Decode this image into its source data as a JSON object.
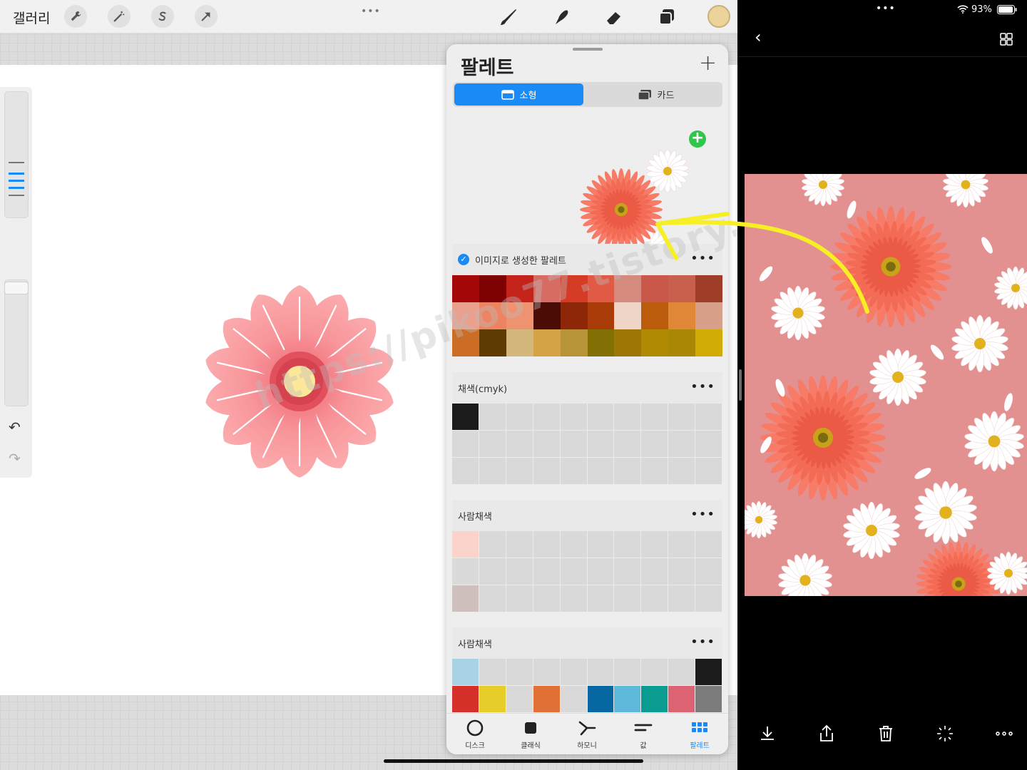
{
  "left_app": {
    "gallery_label": "갤러리",
    "top_more": "•••",
    "color_swatch": "#ebd39a"
  },
  "canvas": {
    "watermark": "https://pikoo77.tistory.com/"
  },
  "palette": {
    "title": "팔레트",
    "add_label": "+",
    "segments": {
      "small": "소형",
      "card": "카드"
    },
    "add_image": "+",
    "sections": [
      {
        "name": "이미지로 생성한 팔레트",
        "default": true,
        "colors": [
          "#a30707",
          "#7f0202",
          "#c4231a",
          "#d76c63",
          "#d63b26",
          "#e05a45",
          "#d58a7e",
          "#c9574a",
          "#c8604e",
          "#a03d28",
          "#e9a18e",
          "#ec8461",
          "#ee9270",
          "#4a0c04",
          "#8e2608",
          "#a93c08",
          "#efd5c8",
          "#bb5b0c",
          "#e08738",
          "#d8a08a",
          "#cc6d26",
          "#5f3c04",
          "#d4b77a",
          "#d3a346",
          "#b69437",
          "#837005",
          "#9d7605",
          "#b08a03",
          "#aa8805",
          "#d1ac04"
        ]
      },
      {
        "name": "채색(cmyk)",
        "colors": [
          "#1b1b1b"
        ]
      },
      {
        "name": "사람채색",
        "colors": [
          "#fcd3ca",
          "",
          "",
          "",
          "",
          "",
          "",
          "",
          "",
          "",
          "#dadada",
          "",
          "",
          "",
          "",
          "",
          "",
          "",
          "",
          "",
          "#cfc0bd"
        ]
      },
      {
        "name": "사람채색",
        "colors": [
          "#a9d3e4",
          "",
          "",
          "",
          "",
          "",
          "",
          "",
          "",
          "#1b1b1b",
          "#d5312a",
          "#e6cd2a",
          "",
          "#e07036",
          "",
          "#0767a3",
          "#5fb9da",
          "#0b9c91",
          "#dc6372",
          "#7c7c7c"
        ]
      }
    ],
    "tabs": [
      "디스크",
      "클래식",
      "하모니",
      "값",
      "팔레트"
    ],
    "more": "•••",
    "check": "✓"
  },
  "viewer": {
    "battery": "93%",
    "more": "•••",
    "back": "‹"
  }
}
